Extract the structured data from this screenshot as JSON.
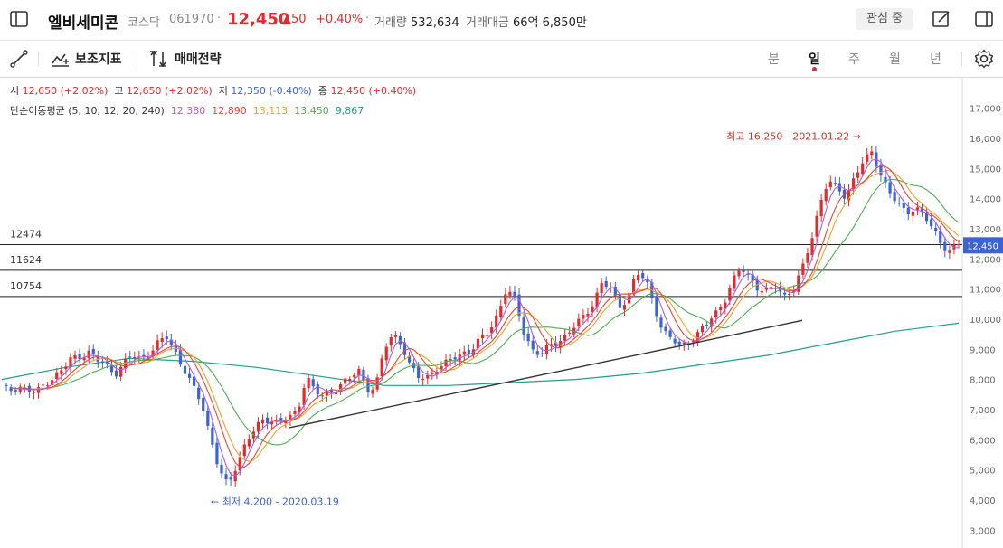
{
  "header": {
    "name": "엘비세미콘",
    "market": "코스닥",
    "code": "061970",
    "separator": "·",
    "price": "12,450",
    "change": "▲50",
    "change_pct": "+0.40%",
    "volume_label": "거래량",
    "volume": "532,634",
    "amount_label": "거래대금",
    "amount": "66억 6,850만",
    "watch_label": "관심 중"
  },
  "toolbar": {
    "indicator_label": "보조지표",
    "strategy_label": "매매전략",
    "periods": [
      "분",
      "일",
      "주",
      "월",
      "년"
    ],
    "active_period": "일"
  },
  "info": {
    "open_label": "시",
    "open": "12,650 (+2.02%)",
    "high_label": "고",
    "high": "12,650 (+2.02%)",
    "low_label": "저",
    "low": "12,350 (-0.40%)",
    "close_label": "종",
    "close": "12,450 (+0.40%)",
    "ma_label": "단순이동평균 (5, 10, 12, 20, 240)",
    "ma_values": [
      "12,380",
      "12,890",
      "13,113",
      "13,450",
      "9,867"
    ]
  },
  "colors": {
    "up": "#e22b2b",
    "down": "#3b63d8",
    "ma5": "#b15ce0",
    "ma10": "#e8463a",
    "ma12": "#f0a02a",
    "ma20": "#4caf50",
    "ma240": "#1f9e8a"
  },
  "chart_data": {
    "type": "line",
    "y_axis_ticks": [
      "17,000",
      "16,000",
      "15,000",
      "14,000",
      "13,000",
      "12,000",
      "11,000",
      "10,000",
      "9,000",
      "8,000",
      "7,000",
      "6,000",
      "5,000",
      "4,000",
      "3,000"
    ],
    "ylim": [
      3000,
      17500
    ],
    "price_levels": [
      {
        "label": "12474",
        "value": 12474
      },
      {
        "label": "11624",
        "value": 11624
      },
      {
        "label": "10754",
        "value": 10754
      }
    ],
    "current_price_tag": "12,450",
    "current_price": 12450,
    "high_annotation": "최고 16,250 - 2021.01.22 →",
    "low_annotation": "← 최저 4,200 - 2020.03.19",
    "close_path": [
      7700,
      7650,
      7800,
      7600,
      7550,
      7900,
      8100,
      8300,
      8700,
      8800,
      8900,
      8600,
      8500,
      8200,
      8500,
      8800,
      8700,
      8900,
      9200,
      9400,
      8900,
      8300,
      7700,
      7200,
      6100,
      5000,
      4400,
      5200,
      5900,
      6300,
      6600,
      6700,
      6600,
      6700,
      6900,
      8200,
      7600,
      7400,
      7600,
      7900,
      8000,
      8300,
      7700,
      7800,
      9000,
      9500,
      9200,
      8400,
      8000,
      8100,
      8400,
      8500,
      8700,
      8900,
      9000,
      9300,
      9600,
      10200,
      11000,
      10600,
      9600,
      9000,
      8800,
      9100,
      9300,
      9500,
      9800,
      10100,
      10600,
      11200,
      11000,
      10400,
      10800,
      11500,
      11300,
      10500,
      9600,
      9300,
      9100,
      9300,
      9500,
      9800,
      10200,
      10600,
      11200,
      11700,
      11400,
      11000,
      10900,
      11100,
      10800,
      11000,
      11600,
      12600,
      13800,
      14600,
      14300,
      14100,
      14700,
      15200,
      15500,
      14900,
      14200,
      13800,
      13500,
      13800,
      13400,
      13000,
      12500,
      12300,
      12450
    ],
    "ma240_path": [
      8000,
      8400,
      8700,
      8600,
      8400,
      8100,
      7800,
      7800,
      7900,
      8000,
      8200,
      8500,
      8800,
      9200,
      9600,
      9867
    ],
    "trendline_from": [
      6400,
      9960
    ]
  }
}
